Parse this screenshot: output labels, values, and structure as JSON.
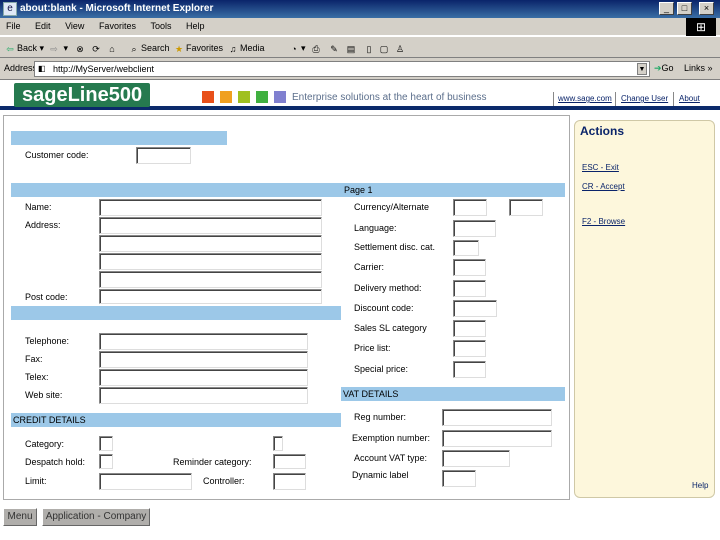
{
  "window": {
    "title": "about:blank - Microsoft Internet Explorer",
    "minimize": "_",
    "maximize": "□",
    "close": "×"
  },
  "menu": [
    "File",
    "Edit",
    "View",
    "Favorites",
    "Tools",
    "Help"
  ],
  "toolbar": {
    "back": "Back",
    "search": "Search",
    "favorites": "Favorites",
    "media": "Media"
  },
  "address": {
    "label": "Address",
    "value": "http://MyServer/webclient",
    "go": "Go",
    "links": "Links"
  },
  "header": {
    "logo": "sageLine500",
    "tagline": "Enterprise solutions at the heart of business",
    "links": [
      "www.sage.com",
      "Change User",
      "About"
    ],
    "colors": [
      "#e8501a",
      "#f0a020",
      "#a0c020",
      "#40b040",
      "#8080d0"
    ]
  },
  "form": {
    "customer_code_label": "Customer code:",
    "page_label": "Page 1",
    "name_label": "Name:",
    "address_label": "Address:",
    "post_code_label": "Post code:",
    "telephone_label": "Telephone:",
    "fax_label": "Fax:",
    "telex_label": "Telex:",
    "website_label": "Web site:",
    "credit_details": "CREDIT DETAILS",
    "category_label": "Category:",
    "despatch_hold_label": "Despatch hold:",
    "reminder_category_label": "Reminder category:",
    "limit_label": "Limit:",
    "controller_label": "Controller:",
    "currency_label": "Currency/Alternate",
    "language_label": "Language:",
    "settlement_label": "Settlement disc. cat.",
    "carrier_label": "Carrier:",
    "delivery_method_label": "Delivery method:",
    "discount_code_label": "Discount code:",
    "sales_category_label": "Sales SL category",
    "price_list_label": "Price list:",
    "special_price_label": "Special price:",
    "vat_details": "VAT DETAILS",
    "reg_number_label": "Reg number:",
    "exemption_number_label": "Exemption number:",
    "account_vat_type_label": "Account VAT type:",
    "dynamic_label": "Dynamic label"
  },
  "actions": {
    "title": "Actions",
    "items": [
      "ESC - Exit",
      "CR - Accept",
      "F2 - Browse"
    ],
    "help": "Help"
  },
  "bottom": {
    "menu": "Menu",
    "application": "Application - Company"
  }
}
